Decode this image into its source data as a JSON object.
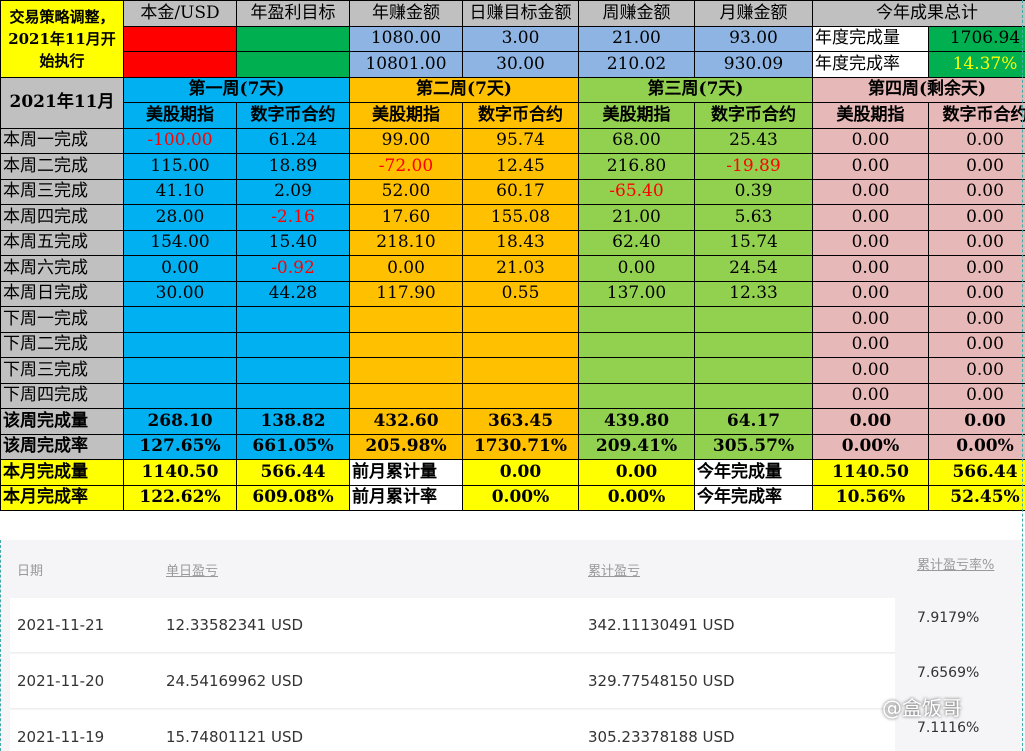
{
  "header": {
    "note": "交易策略调整，2021年11月开始执行",
    "cols": [
      "本金/USD",
      "年盈利目标",
      "年赚金额",
      "日赚目标金额",
      "周赚金额",
      "月赚金额",
      "今年成果总计"
    ],
    "row1": [
      "1080.00",
      "3.00",
      "21.00",
      "93.00"
    ],
    "row2": [
      "10801.00",
      "30.00",
      "210.02",
      "930.09"
    ],
    "year_done_label": "年度完成量",
    "year_done_value": "1706.94",
    "year_rate_label": "年度完成率",
    "year_rate_value": "14.37%"
  },
  "month_label": "2021年11月",
  "weeks": [
    "第一周(7天)",
    "第二周(7天)",
    "第三周(7天)",
    "第四周(剩余天)"
  ],
  "sub_a": "美股期指",
  "sub_b": "数字币合约",
  "days": [
    {
      "label": "本周一完成",
      "v": [
        "-100.00",
        "61.24",
        "99.00",
        "95.74",
        "68.00",
        "25.43",
        "0.00",
        "0.00"
      ]
    },
    {
      "label": "本周二完成",
      "v": [
        "115.00",
        "18.89",
        "-72.00",
        "12.45",
        "216.80",
        "-19.89",
        "0.00",
        "0.00"
      ]
    },
    {
      "label": "本周三完成",
      "v": [
        "41.10",
        "2.09",
        "52.00",
        "60.17",
        "-65.40",
        "0.39",
        "0.00",
        "0.00"
      ]
    },
    {
      "label": "本周四完成",
      "v": [
        "28.00",
        "-2.16",
        "17.60",
        "155.08",
        "21.00",
        "5.63",
        "0.00",
        "0.00"
      ]
    },
    {
      "label": "本周五完成",
      "v": [
        "154.00",
        "15.40",
        "218.10",
        "18.43",
        "62.40",
        "15.74",
        "0.00",
        "0.00"
      ]
    },
    {
      "label": "本周六完成",
      "v": [
        "0.00",
        "-0.92",
        "0.00",
        "21.03",
        "0.00",
        "24.54",
        "0.00",
        "0.00"
      ]
    },
    {
      "label": "本周日完成",
      "v": [
        "30.00",
        "44.28",
        "117.90",
        "0.55",
        "137.00",
        "12.33",
        "0.00",
        "0.00"
      ]
    },
    {
      "label": "下周一完成",
      "v": [
        "",
        "",
        "",
        "",
        "",
        "",
        "0.00",
        "0.00"
      ]
    },
    {
      "label": "下周二完成",
      "v": [
        "",
        "",
        "",
        "",
        "",
        "",
        "0.00",
        "0.00"
      ]
    },
    {
      "label": "下周三完成",
      "v": [
        "",
        "",
        "",
        "",
        "",
        "",
        "0.00",
        "0.00"
      ]
    },
    {
      "label": "下周四完成",
      "v": [
        "",
        "",
        "",
        "",
        "",
        "",
        "0.00",
        "0.00"
      ]
    }
  ],
  "week_total": {
    "label": "该周完成量",
    "v": [
      "268.10",
      "138.82",
      "432.60",
      "363.45",
      "439.80",
      "64.17",
      "0.00",
      "0.00"
    ]
  },
  "week_rate": {
    "label": "该周完成率",
    "v": [
      "127.65%",
      "661.05%",
      "205.98%",
      "1730.71%",
      "209.41%",
      "305.57%",
      "0.00%",
      "0.00%"
    ]
  },
  "month_total": {
    "label": "本月完成量",
    "a": "1140.50",
    "b": "566.44",
    "prev_label": "前月累计量",
    "prev_a": "0.00",
    "prev_b": "0.00",
    "year_label": "今年完成量",
    "year_a": "1140.50",
    "year_b": "566.44"
  },
  "month_rate": {
    "label": "本月完成率",
    "a": "122.62%",
    "b": "609.08%",
    "prev_label": "前月累计率",
    "prev_a": "0.00%",
    "prev_b": "0.00%",
    "year_label": "今年完成率",
    "year_a": "10.56%",
    "year_b": "52.45%"
  },
  "pnl_table": {
    "headers": [
      "日期",
      "单日盈亏",
      "累计盈亏",
      "累计盈亏率%"
    ],
    "rows": [
      {
        "date": "2021-11-21",
        "daily": "12.33582341 USD",
        "cum": "342.11130491 USD",
        "rate": "7.9179%"
      },
      {
        "date": "2021-11-20",
        "daily": "24.54169962 USD",
        "cum": "329.77548150 USD",
        "rate": "7.6569%"
      },
      {
        "date": "2021-11-19",
        "daily": "15.74801121 USD",
        "cum": "305.23378188 USD",
        "rate": "7.1116%"
      }
    ]
  },
  "watermark": "@盒饭哥",
  "colors": {
    "blue": "#00b0f0",
    "orange": "#ffc000",
    "green": "#92d050",
    "pink": "#e6b8b7",
    "yellow": "#ffff00",
    "red_text": "#ff0000"
  }
}
